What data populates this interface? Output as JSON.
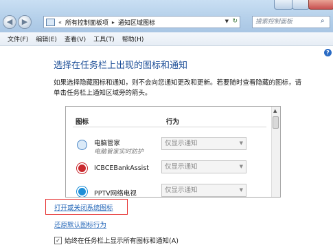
{
  "addressbar": {
    "breadcrumb_lead": "«",
    "crumbs": [
      "所有控制面板项",
      "通知区域图标"
    ],
    "separator": "▸"
  },
  "search": {
    "placeholder": "搜索控制面板"
  },
  "menu": {
    "items": [
      "文件(F)",
      "编辑(E)",
      "查看(V)",
      "工具(T)",
      "帮助(H)"
    ]
  },
  "page": {
    "heading": "选择在任务栏上出现的图标和通知",
    "description": "如果选择隐藏图标和通知，则不会向您通知更改和更新。若要随时查看隐藏的图标，请单击任务栏上通知区域旁的箭头。"
  },
  "table": {
    "columns": [
      "图标",
      "行为"
    ],
    "rows": [
      {
        "name": "电脑管家",
        "sub": "电脑管家实时防护",
        "behavior": "仅显示通知",
        "icon": "shield-icon"
      },
      {
        "name": "ICBCEBankAssist",
        "sub": "",
        "behavior": "仅显示通知",
        "icon": "icbc-logo-icon"
      },
      {
        "name": "PPTV网络电视",
        "sub": "",
        "behavior": "仅显示通知",
        "icon": "pptv-icon"
      }
    ]
  },
  "links": {
    "system_icons": "打开或关闭系统图标",
    "restore": "还原默认图标行为"
  },
  "checkbox": {
    "label": "始终在任务栏上显示所有图标和通知(A)",
    "checked": true
  },
  "colors": {
    "accent": "#1c4e97",
    "link": "#2366b8",
    "highlight": "#e52b2b"
  }
}
